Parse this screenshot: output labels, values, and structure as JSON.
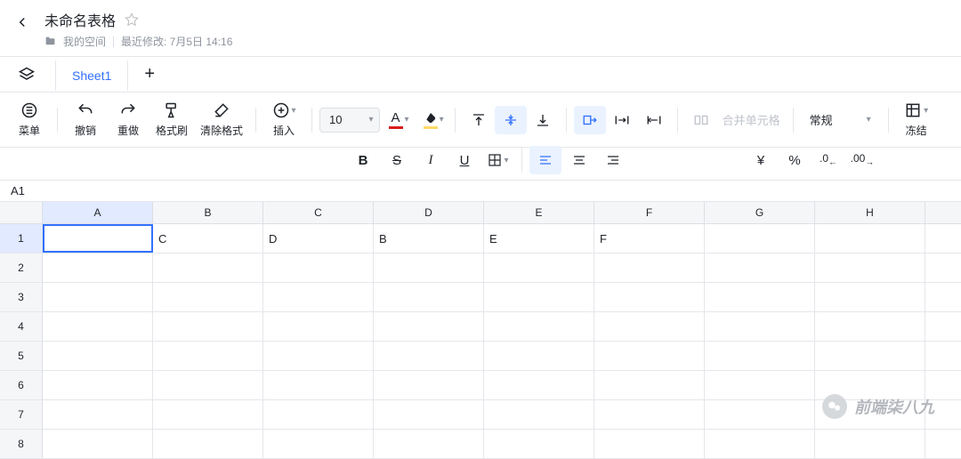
{
  "header": {
    "title": "未命名表格",
    "folder": "我的空间",
    "last_modified_label": "最近修改: 7月5日 14:16"
  },
  "tabs": {
    "sheet1": "Sheet1"
  },
  "toolbar": {
    "menu": "菜单",
    "undo": "撤销",
    "redo": "重做",
    "format_painter": "格式刷",
    "clear_format": "清除格式",
    "insert": "插入",
    "font_size": "10",
    "merge_cells": "合并单元格",
    "number_format": "常规",
    "freeze": "冻结"
  },
  "name_box": "A1",
  "columns": [
    "A",
    "B",
    "C",
    "D",
    "E",
    "F",
    "G",
    "H"
  ],
  "rows": [
    1,
    2,
    3,
    4,
    5,
    6,
    7,
    8
  ],
  "cells": {
    "r1": [
      "",
      "C",
      "D",
      "B",
      "E",
      "F",
      "",
      ""
    ]
  },
  "selected": {
    "row": 1,
    "col": 0
  },
  "watermark": "前端柒八九"
}
